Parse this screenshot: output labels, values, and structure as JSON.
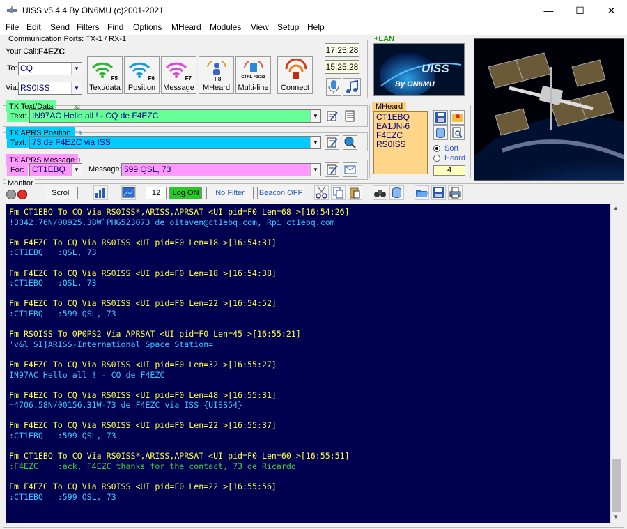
{
  "window": {
    "title": "UISS v5.4.4 By ON6MU (c)2001-2021",
    "minimize": "—",
    "maximize": "☐",
    "close": "✕"
  },
  "menu": [
    "File",
    "Edit",
    "Send",
    "Filters",
    "Find",
    "Options",
    "MHeard",
    "Modules",
    "View",
    "Setup",
    "Help"
  ],
  "ports": {
    "group_label": "Communication Ports: TX-1 / RX-1",
    "your_call_label": "Your Call:",
    "your_call": "F4EZC",
    "to_label": "To:",
    "to_value": "CQ",
    "via_label": "Via:",
    "via_value": "RS0ISS"
  },
  "toolbar": [
    {
      "label": "Text/data",
      "key": "F5",
      "icon": "wifi-text-icon",
      "color": "#2bb52b"
    },
    {
      "label": "Position",
      "key": "F6",
      "icon": "wifi-position-icon",
      "color": "#1a9ad8"
    },
    {
      "label": "Message",
      "key": "F7",
      "icon": "wifi-message-icon",
      "color": "#d64bd6"
    },
    {
      "label": "MHeard",
      "key": "F8",
      "icon": "mheard-users-icon",
      "color": "#e39a1a"
    },
    {
      "label": "Multi-line",
      "key": "CTRL F1/2/3",
      "icon": "multiline-icon",
      "color": "#e05050"
    },
    {
      "label": "Connect",
      "key": "",
      "icon": "connect-icon",
      "color": "#d83a1a"
    }
  ],
  "clocks": {
    "local": "17:25:28",
    "utc": "15:25:28"
  },
  "lan": {
    "label": "+LAN",
    "logo_text": "UISS",
    "logo_sub": "By ON6MU"
  },
  "tx_text": {
    "group_label": "TX Text/Data",
    "count": "32",
    "field_label": "Text:",
    "value": "IN97AC Hello all ! - CQ de F4EZC"
  },
  "tx_position": {
    "group_label": "TX APRS Position",
    "count": "19",
    "field_label": "Text:",
    "value": "73 de F4EZC via ISS"
  },
  "tx_message": {
    "group_label": "TX APRS Message",
    "count": "11",
    "for_label": "For:",
    "for_value": "CT1EBQ",
    "msg_label": "Message:",
    "value": "599 QSL, 73"
  },
  "mheard": {
    "group_label": "MHeard",
    "list": [
      "CT1EBQ",
      "EA1JN-6",
      "F4EZC",
      "RS0ISS"
    ],
    "sort_label": "Sort",
    "heard_label": "Heard",
    "count": "4"
  },
  "monitor": {
    "group_label": "Monitor",
    "scroll": "Scroll",
    "font_size": "12",
    "log": "Log ON",
    "filter": "No Filter",
    "beacon": "Beacon OFF"
  },
  "log_lines": [
    {
      "t": "Fm CT1EBQ To CQ Via RS0ISS*,ARISS,APRSAT <UI pid=F0 Len=68 >[16:54:26]",
      "c": "#ffff44"
    },
    {
      "t": "!3842.76N/00925.38W`PHG523073 de oitaven@ct1ebq.com, Rpi ct1ebq.com",
      "c": "#38c8ff"
    },
    {
      "t": "",
      "c": "#fff"
    },
    {
      "t": "Fm F4EZC To CQ Via RS0ISS <UI pid=F0 Len=18 >[16:54:31]",
      "c": "#ffff44"
    },
    {
      "t": ":CT1EBQ   :QSL, 73",
      "c": "#38c8ff"
    },
    {
      "t": "",
      "c": "#fff"
    },
    {
      "t": "Fm F4EZC To CQ Via RS0ISS <UI pid=F0 Len=18 >[16:54:38]",
      "c": "#ffff44"
    },
    {
      "t": ":CT1EBQ   :QSL, 73",
      "c": "#38c8ff"
    },
    {
      "t": "",
      "c": "#fff"
    },
    {
      "t": "Fm F4EZC To CQ Via RS0ISS <UI pid=F0 Len=22 >[16:54:52]",
      "c": "#ffff44"
    },
    {
      "t": ":CT1EBQ   :599 QSL, 73",
      "c": "#38c8ff"
    },
    {
      "t": "",
      "c": "#fff"
    },
    {
      "t": "Fm RS0ISS To 0P0PS2 Via APRSAT <UI pid=F0 Len=45 >[16:55:21]",
      "c": "#ffff44"
    },
    {
      "t": "'v&l SI]ARISS-International Space Station=",
      "c": "#38c8ff"
    },
    {
      "t": "",
      "c": "#fff"
    },
    {
      "t": "Fm F4EZC To CQ Via RS0ISS <UI pid=F0 Len=32 >[16:55:27]",
      "c": "#ffff44"
    },
    {
      "t": "IN97AC Hello all ! - CQ de F4EZC",
      "c": "#38c8ff"
    },
    {
      "t": "",
      "c": "#fff"
    },
    {
      "t": "Fm F4EZC To CQ Via RS0ISS <UI pid=F0 Len=48 >[16:55:31]",
      "c": "#ffff44"
    },
    {
      "t": "=4706.58N/00156.31W-73 de F4EZC via ISS {UISS54}",
      "c": "#38c8ff"
    },
    {
      "t": "",
      "c": "#fff"
    },
    {
      "t": "Fm F4EZC To CQ Via RS0ISS <UI pid=F0 Len=22 >[16:55:37]",
      "c": "#ffff44"
    },
    {
      "t": ":CT1EBQ   :599 QSL, 73",
      "c": "#38c8ff"
    },
    {
      "t": "",
      "c": "#fff"
    },
    {
      "t": "Fm CT1EBQ To CQ Via RS0ISS*,ARISS,APRSAT <UI pid=F0 Len=60 >[16:55:51]",
      "c": "#ffff44"
    },
    {
      "t": ":F4EZC    :ack, F4EZC thanks for the contact, 73 de Ricardo",
      "c": "#3cd23c"
    },
    {
      "t": "",
      "c": "#fff"
    },
    {
      "t": "Fm F4EZC To CQ Via RS0ISS <UI pid=F0 Len=22 >[16:55:56]",
      "c": "#ffff44"
    },
    {
      "t": ":CT1EBQ   :599 QSL, 73",
      "c": "#38c8ff"
    }
  ]
}
